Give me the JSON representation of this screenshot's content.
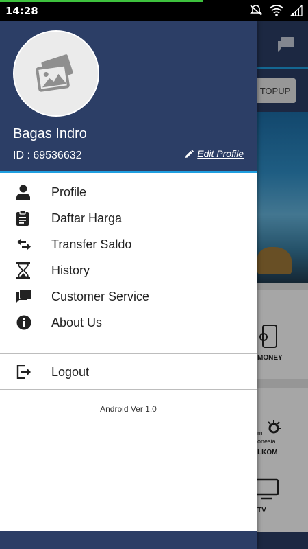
{
  "status_bar": {
    "time": "14:28",
    "download_progress": 0.66,
    "icons": [
      "mute-icon",
      "wifi-icon",
      "signal-icon"
    ]
  },
  "background_app": {
    "topup_label": "TOPUP",
    "menu_labels": [
      "MONEY",
      "LKOM",
      "TV"
    ],
    "telkom_logo_text": [
      "m",
      "onesia"
    ]
  },
  "drawer": {
    "user": {
      "name": "Bagas Indro",
      "id": "ID : 69536632",
      "edit_label": "Edit Profile"
    },
    "menu": [
      {
        "label": "Profile",
        "icon": "person-icon"
      },
      {
        "label": "Daftar Harga",
        "icon": "clipboard-icon"
      },
      {
        "label": "Transfer Saldo",
        "icon": "swap-arrows-icon"
      },
      {
        "label": "History",
        "icon": "hourglass-icon"
      },
      {
        "label": "Customer Service",
        "icon": "chat-icon"
      },
      {
        "label": "About Us",
        "icon": "info-icon"
      }
    ],
    "logout_label": "Logout",
    "version": "Android Ver 1.0"
  },
  "colors": {
    "primary": "#2c3e66",
    "accent": "#1f9fe0",
    "progress": "#3ec23e"
  }
}
